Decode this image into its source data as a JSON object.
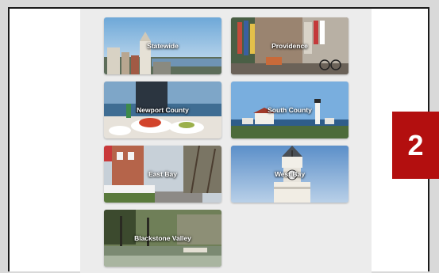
{
  "tiles": [
    {
      "label": "Statewide"
    },
    {
      "label": "Providence"
    },
    {
      "label": "Newport County"
    },
    {
      "label": "South County"
    },
    {
      "label": "East Bay"
    },
    {
      "label": "West Bay"
    },
    {
      "label": "Blackstone Valley"
    }
  ],
  "badge": {
    "number": "2",
    "color": "#b30f0f"
  }
}
